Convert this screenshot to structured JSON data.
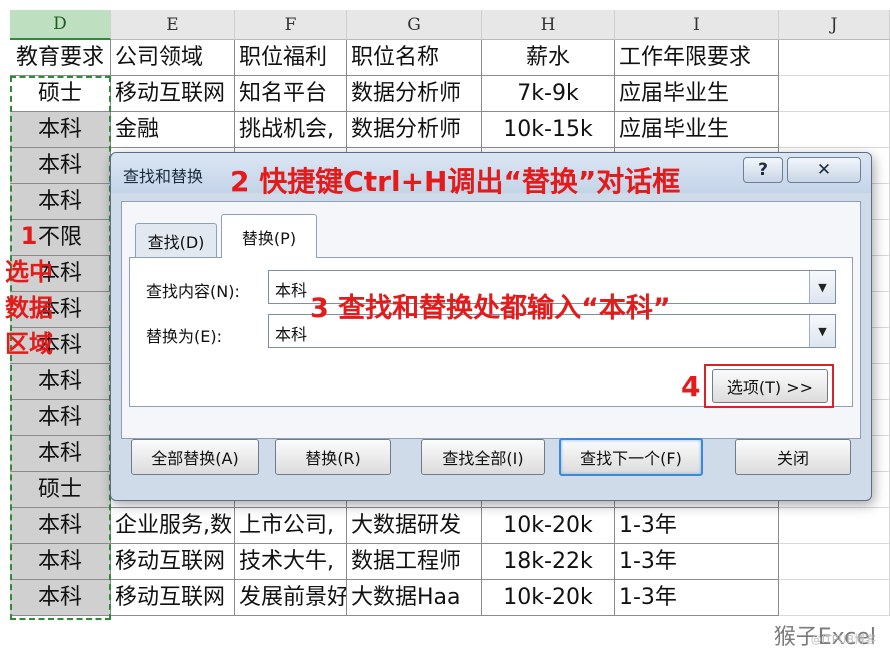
{
  "sheet": {
    "col_headers": [
      "D",
      "E",
      "F",
      "G",
      "H",
      "I",
      "J"
    ],
    "header_row": [
      "教育要求",
      "公司领域",
      "职位福利",
      "职位名称",
      "薪水",
      "工作年限要求"
    ],
    "rows": [
      [
        "硕士",
        "移动互联网",
        "知名平台",
        "数据分析师",
        "7k-9k",
        "应届毕业生"
      ],
      [
        "本科",
        "金融",
        "挑战机会,",
        "数据分析师",
        "10k-15k",
        "应届毕业生"
      ],
      [
        "本科",
        "",
        "",
        "",
        "",
        ""
      ],
      [
        "本科",
        "",
        "",
        "",
        "",
        ""
      ],
      [
        "不限",
        "",
        "",
        "",
        "",
        ""
      ],
      [
        "本科",
        "",
        "",
        "",
        "",
        ""
      ],
      [
        "本科",
        "",
        "",
        "",
        "",
        ""
      ],
      [
        "本科",
        "",
        "",
        "",
        "",
        ""
      ],
      [
        "本科",
        "",
        "",
        "",
        "",
        ""
      ],
      [
        "本科",
        "",
        "",
        "",
        "",
        ""
      ],
      [
        "本科",
        "",
        "",
        "",
        "",
        ""
      ],
      [
        "硕士",
        "",
        "",
        "",
        "",
        ""
      ],
      [
        "本科",
        "企业服务,数",
        "上市公司,",
        "大数据研发",
        "10k-20k",
        "1-3年"
      ],
      [
        "本科",
        "移动互联网",
        "技术大牛,",
        "数据工程师",
        "18k-22k",
        "1-3年"
      ],
      [
        "本科",
        "移动互联网",
        "发展前景好",
        "大数据Haa",
        "10k-20k",
        "1-3年"
      ]
    ]
  },
  "dialog": {
    "title": "查找和替换",
    "help_label": "?",
    "close_label": "✕",
    "tabs": [
      {
        "label": "查找(D)"
      },
      {
        "label": "替换(P)"
      }
    ],
    "find_label": "查找内容(N):",
    "find_value": "本科",
    "replace_label": "替换为(E):",
    "replace_value": "本科",
    "options_label": "选项(T) >>",
    "buttons": {
      "replace_all": "全部替换(A)",
      "replace": "替换(R)",
      "find_all": "查找全部(I)",
      "find_next": "查找下一个(F)",
      "close": "关闭"
    }
  },
  "annotations": {
    "step1": "1\n选中\n数据\n区域",
    "step2": "2 快捷键Ctrl+H调出“替换”对话框",
    "step3": "3  查找和替换处都输入“本科”",
    "step4": "4"
  },
  "watermark": {
    "main": "猴子Excel",
    "sub": "@ITPUB博客"
  },
  "colors": {
    "annotation_red": "#e31b1b",
    "selection_green": "#2e8b3a",
    "dialog_blue": "#cfdbe9"
  }
}
